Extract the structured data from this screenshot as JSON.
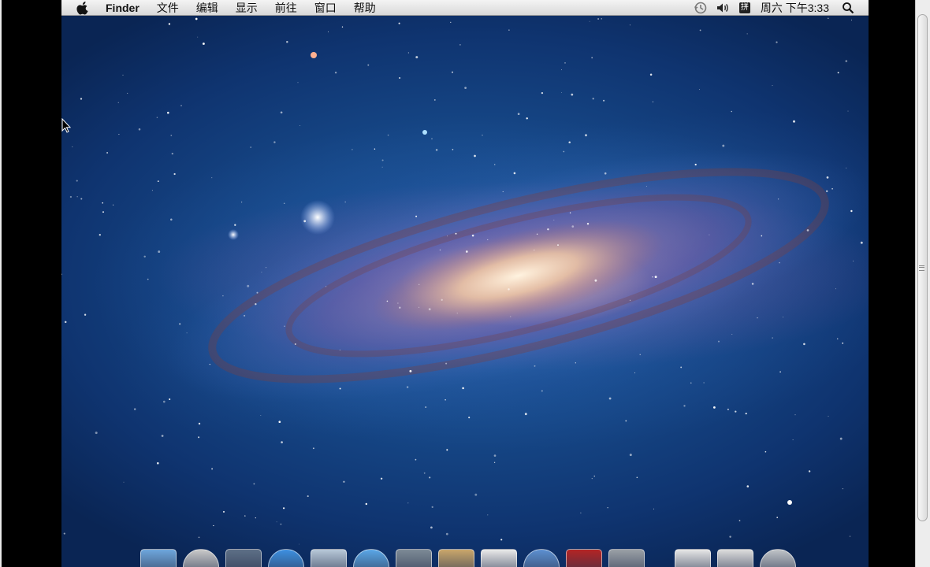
{
  "menubar": {
    "apple_menu_icon": "apple-logo-icon",
    "app_name": "Finder",
    "items": [
      "文件",
      "编辑",
      "显示",
      "前往",
      "窗口",
      "帮助"
    ],
    "status": {
      "time_machine_icon": "time-machine-icon",
      "volume_icon": "volume-icon",
      "input_method": "拼",
      "clock": "周六 下午3:33",
      "spotlight_icon": "spotlight-search-icon"
    }
  },
  "desktop": {
    "wallpaper": "andromeda-galaxy"
  },
  "dock": {
    "items": [
      {
        "name": "finder",
        "icon": "finder-icon",
        "color": "#6ea6dc"
      },
      {
        "name": "launchpad",
        "icon": "launchpad-icon",
        "color": "#c9c9c9"
      },
      {
        "name": "mission-control",
        "icon": "mission-control-icon",
        "color": "#5d6f86"
      },
      {
        "name": "app-store",
        "icon": "app-store-icon",
        "color": "#3d8fe0"
      },
      {
        "name": "mail",
        "icon": "mail-icon",
        "color": "#b7c8d8"
      },
      {
        "name": "safari",
        "icon": "safari-icon",
        "color": "#5aa6e6"
      },
      {
        "name": "facetime",
        "icon": "facetime-icon",
        "color": "#7d8a96"
      },
      {
        "name": "contacts",
        "icon": "address-book-icon",
        "color": "#c9a66b"
      },
      {
        "name": "calendar",
        "icon": "ical-icon",
        "color": "#e9e9e9"
      },
      {
        "name": "itunes",
        "icon": "itunes-icon",
        "color": "#5c8fd0"
      },
      {
        "name": "photo-booth",
        "icon": "photo-booth-icon",
        "color": "#b32424"
      },
      {
        "name": "system-preferences",
        "icon": "system-preferences-icon",
        "color": "#9aa0a6"
      },
      {
        "name": "documents",
        "icon": "document-icon",
        "color": "#e6e6e6"
      },
      {
        "name": "downloads",
        "icon": "downloads-icon",
        "color": "#dcdcdc"
      },
      {
        "name": "trash",
        "icon": "trash-icon",
        "color": "#bfc3c7"
      }
    ]
  }
}
